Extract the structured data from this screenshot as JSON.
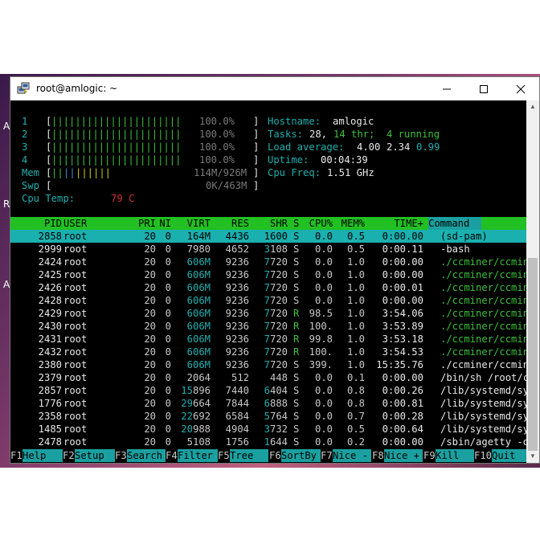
{
  "window": {
    "title": "root@amlogic: ~"
  },
  "desktop_letters": [
    "A",
    "R",
    "A"
  ],
  "meters": {
    "cpus": [
      {
        "id": "1",
        "percent": "100.0%"
      },
      {
        "id": "2",
        "percent": "100.0%"
      },
      {
        "id": "3",
        "percent": "100.0%"
      },
      {
        "id": "4",
        "percent": "100.0%"
      }
    ],
    "mem": {
      "label": "Mem",
      "value": "114M/926M"
    },
    "swp": {
      "label": "Swp",
      "value": "0K/463M"
    },
    "cpu_temp": {
      "label": "Cpu Temp:",
      "value": "79 C"
    }
  },
  "sysinfo": {
    "hostname_label": "Hostname:",
    "hostname": "amlogic",
    "tasks_label": "Tasks:",
    "tasks": "28,",
    "thr": "14 thr;",
    "running": "4 running",
    "load_label": "Load average:",
    "load1": "4.00",
    "load5": "2.34",
    "load15": "0.99",
    "uptime_label": "Uptime:",
    "uptime": "00:04:39",
    "freq_label": "Cpu Freq:",
    "freq": "1.51 GHz"
  },
  "columns": [
    "PID",
    "USER",
    "PRI",
    "NI",
    "VIRT",
    "RES",
    "SHR",
    "S",
    "CPU%",
    "MEM%",
    "TIME+",
    "Command"
  ],
  "processes": [
    {
      "pid": "2858",
      "user": "root",
      "pri": "20",
      "ni": "0",
      "virt": "164M",
      "res": "4436",
      "shr": "1600",
      "s": "S",
      "cpu": "0.0",
      "mem": "0.5",
      "time": "0:00.00",
      "cmd": "(sd-pam)"
    },
    {
      "pid": "2999",
      "user": "root",
      "pri": "20",
      "ni": "0",
      "virt": "7980",
      "res": "4652",
      "shr": "3108",
      "s": "S",
      "cpu": "0.0",
      "mem": "0.5",
      "time": "0:00.11",
      "cmd": "-bash"
    },
    {
      "pid": "2424",
      "user": "root",
      "pri": "20",
      "ni": "0",
      "virt": "606M",
      "res": "9236",
      "shr": "7720",
      "s": "S",
      "cpu": "0.0",
      "mem": "1.0",
      "time": "0:00.00",
      "cmd": "./ccminer/ccmin"
    },
    {
      "pid": "2425",
      "user": "root",
      "pri": "20",
      "ni": "0",
      "virt": "606M",
      "res": "9236",
      "shr": "7720",
      "s": "S",
      "cpu": "0.0",
      "mem": "1.0",
      "time": "0:00.00",
      "cmd": "./ccminer/ccmin"
    },
    {
      "pid": "2426",
      "user": "root",
      "pri": "20",
      "ni": "0",
      "virt": "606M",
      "res": "9236",
      "shr": "7720",
      "s": "S",
      "cpu": "0.0",
      "mem": "1.0",
      "time": "0:00.01",
      "cmd": "./ccminer/ccmin"
    },
    {
      "pid": "2428",
      "user": "root",
      "pri": "20",
      "ni": "0",
      "virt": "606M",
      "res": "9236",
      "shr": "7720",
      "s": "S",
      "cpu": "0.0",
      "mem": "1.0",
      "time": "0:00.00",
      "cmd": "./ccminer/ccmin"
    },
    {
      "pid": "2429",
      "user": "root",
      "pri": "20",
      "ni": "0",
      "virt": "606M",
      "res": "9236",
      "shr": "7720",
      "s": "R",
      "cpu": "98.5",
      "mem": "1.0",
      "time": "3:54.06",
      "cmd": "./ccminer/ccmin"
    },
    {
      "pid": "2430",
      "user": "root",
      "pri": "20",
      "ni": "0",
      "virt": "606M",
      "res": "9236",
      "shr": "7720",
      "s": "R",
      "cpu": "100.",
      "mem": "1.0",
      "time": "3:53.89",
      "cmd": "./ccminer/ccmin"
    },
    {
      "pid": "2431",
      "user": "root",
      "pri": "20",
      "ni": "0",
      "virt": "606M",
      "res": "9236",
      "shr": "7720",
      "s": "R",
      "cpu": "99.8",
      "mem": "1.0",
      "time": "3:53.18",
      "cmd": "./ccminer/ccmin"
    },
    {
      "pid": "2432",
      "user": "root",
      "pri": "20",
      "ni": "0",
      "virt": "606M",
      "res": "9236",
      "shr": "7720",
      "s": "R",
      "cpu": "100.",
      "mem": "1.0",
      "time": "3:54.53",
      "cmd": "./ccminer/ccmin"
    },
    {
      "pid": "2380",
      "user": "root",
      "pri": "20",
      "ni": "0",
      "virt": "606M",
      "res": "9236",
      "shr": "7720",
      "s": "S",
      "cpu": "399.",
      "mem": "1.0",
      "time": "15:35.76",
      "cmd": "./ccminer/ccmin"
    },
    {
      "pid": "2379",
      "user": "root",
      "pri": "20",
      "ni": "0",
      "virt": "2064",
      "res": "512",
      "shr": "448",
      "s": "S",
      "cpu": "0.0",
      "mem": "0.1",
      "time": "0:00.00",
      "cmd": "/bin/sh /root/c"
    },
    {
      "pid": "2857",
      "user": "root",
      "pri": "20",
      "ni": "0",
      "virt": "15896",
      "res": "7440",
      "shr": "6404",
      "s": "S",
      "cpu": "0.0",
      "mem": "0.8",
      "time": "0:00.26",
      "cmd": "/lib/systemd/sy"
    },
    {
      "pid": "1776",
      "user": "root",
      "pri": "20",
      "ni": "0",
      "virt": "29664",
      "res": "7844",
      "shr": "6888",
      "s": "S",
      "cpu": "0.0",
      "mem": "0.8",
      "time": "0:00.81",
      "cmd": "/lib/systemd/sy"
    },
    {
      "pid": "2358",
      "user": "root",
      "pri": "20",
      "ni": "0",
      "virt": "22692",
      "res": "6584",
      "shr": "5764",
      "s": "S",
      "cpu": "0.0",
      "mem": "0.7",
      "time": "0:00.28",
      "cmd": "/lib/systemd/sy"
    },
    {
      "pid": "1485",
      "user": "root",
      "pri": "20",
      "ni": "0",
      "virt": "20988",
      "res": "4904",
      "shr": "3732",
      "s": "S",
      "cpu": "0.0",
      "mem": "0.5",
      "time": "0:00.64",
      "cmd": "/lib/systemd/sy"
    },
    {
      "pid": "2478",
      "user": "root",
      "pri": "20",
      "ni": "0",
      "virt": "5108",
      "res": "1756",
      "shr": "1644",
      "s": "S",
      "cpu": "0.0",
      "mem": "0.2",
      "time": "0:00.00",
      "cmd": "/sbin/agetty -o"
    }
  ],
  "fkeys": [
    {
      "key": "F1",
      "label": "Help"
    },
    {
      "key": "F2",
      "label": "Setup"
    },
    {
      "key": "F3",
      "label": "Search"
    },
    {
      "key": "F4",
      "label": "Filter"
    },
    {
      "key": "F5",
      "label": "Tree"
    },
    {
      "key": "F6",
      "label": "SortBy"
    },
    {
      "key": "F7",
      "label": "Nice -"
    },
    {
      "key": "F8",
      "label": "Nice +"
    },
    {
      "key": "F9",
      "label": "Kill"
    },
    {
      "key": "F10",
      "label": "Quit"
    }
  ]
}
